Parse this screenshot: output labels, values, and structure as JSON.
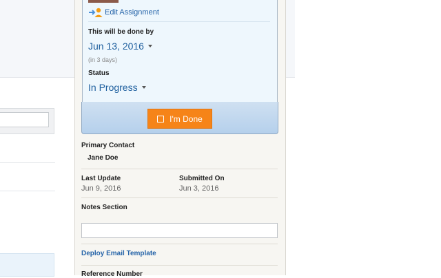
{
  "assignment": {
    "edit_label": "Edit Assignment",
    "due_label": "This will be done by",
    "due_date": "Jun 13, 2016",
    "due_relative": "(in 3 days)",
    "status_label": "Status",
    "status_value": "In Progress",
    "done_button": "I'm Done"
  },
  "details": {
    "primary_contact_label": "Primary Contact",
    "primary_contact_value": "Jane Doe",
    "last_update_label": "Last Update",
    "last_update_value": "Jun 9, 2016",
    "submitted_label": "Submitted On",
    "submitted_value": "Jun 3, 2016",
    "notes_label": "Notes Section",
    "notes_value": "",
    "deploy_link": "Deploy Email Template",
    "reference_label": "Reference Number"
  },
  "colors": {
    "accent_orange": "#f68418",
    "link_blue": "#2463a8"
  }
}
